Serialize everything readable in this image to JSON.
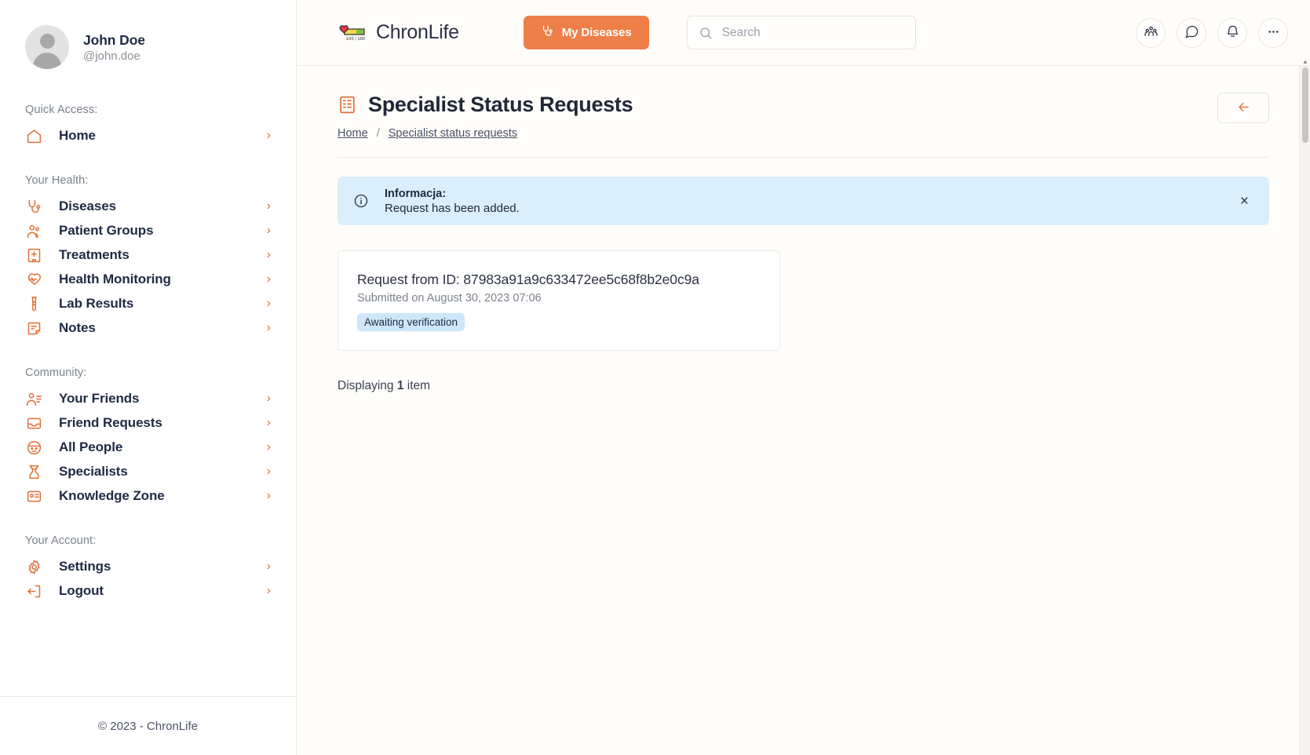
{
  "profile": {
    "name": "John Doe",
    "handle": "@john.doe",
    "avatar_icon": "user-avatar-placeholder"
  },
  "sidebar": {
    "groups": [
      {
        "label": "Quick Access:",
        "items": [
          {
            "label": "Home",
            "icon": "home-icon"
          }
        ]
      },
      {
        "label": "Your Health:",
        "items": [
          {
            "label": "Diseases",
            "icon": "stethoscope-icon"
          },
          {
            "label": "Patient Groups",
            "icon": "users-group-icon"
          },
          {
            "label": "Treatments",
            "icon": "hospital-icon"
          },
          {
            "label": "Health Monitoring",
            "icon": "heart-pulse-icon"
          },
          {
            "label": "Lab Results",
            "icon": "test-tube-icon"
          },
          {
            "label": "Notes",
            "icon": "note-icon"
          }
        ]
      },
      {
        "label": "Community:",
        "items": [
          {
            "label": "Your Friends",
            "icon": "user-list-icon"
          },
          {
            "label": "Friend Requests",
            "icon": "inbox-icon"
          },
          {
            "label": "All People",
            "icon": "globe-face-icon"
          },
          {
            "label": "Specialists",
            "icon": "doctor-icon"
          },
          {
            "label": "Knowledge Zone",
            "icon": "id-card-icon"
          }
        ]
      },
      {
        "label": "Your Account:",
        "items": [
          {
            "label": "Settings",
            "icon": "gear-icon"
          },
          {
            "label": "Logout",
            "icon": "logout-icon"
          }
        ]
      }
    ],
    "chevron": "›",
    "footer": "© 2023 - ChronLife"
  },
  "topbar": {
    "brand_name": "ChronLife",
    "brand_logo_icon": "heart-healthbar-logo",
    "my_diseases_label": "My Diseases",
    "my_diseases_icon": "stethoscope-icon",
    "search_placeholder": "Search",
    "search_value": "",
    "search_icon": "search-icon",
    "actions": [
      {
        "icon": "people-group-icon",
        "name": "groups-button"
      },
      {
        "icon": "chat-bubble-icon",
        "name": "messages-button"
      },
      {
        "icon": "bell-icon",
        "name": "notifications-button"
      },
      {
        "icon": "ellipsis-icon",
        "name": "more-options-button"
      }
    ]
  },
  "page": {
    "title": "Specialist Status Requests",
    "title_icon": "document-list-icon",
    "back_icon": "arrow-left-icon",
    "breadcrumb": [
      {
        "label": "Home",
        "link": true
      },
      {
        "label": "/",
        "link": false
      },
      {
        "label": "Specialist status requests",
        "link": true
      }
    ]
  },
  "alert": {
    "icon": "info-circle-icon",
    "title": "Informacja:",
    "message": "Request has been added.",
    "close_icon": "×",
    "background": "#daeefb"
  },
  "request_card": {
    "title": "Request from ID: 87983a91a9c633472ee5c68f8b2e0c9a",
    "submitted": "Submitted on August 30, 2023 07:06",
    "status": "Awaiting verification",
    "status_background": "#cfe6fa"
  },
  "footer_count": {
    "prefix": "Displaying ",
    "count": "1",
    "suffix": " item"
  },
  "colors": {
    "accent": "#e2703a",
    "button": "#ef7f48",
    "text_dark": "#1f2a44",
    "text_muted": "#7b818d",
    "info_bg": "#daeefb"
  }
}
